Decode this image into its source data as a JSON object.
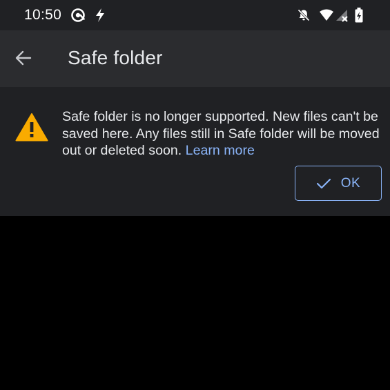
{
  "status_bar": {
    "time": "10:50",
    "icons": [
      "at-sign-icon",
      "flash-icon",
      "notifications-off-icon",
      "wifi-icon",
      "cellular-no-signal-icon",
      "battery-charging-icon"
    ]
  },
  "app_bar": {
    "title": "Safe folder",
    "back_icon": "arrow-back-icon"
  },
  "banner": {
    "icon": "warning-icon",
    "message": "Safe folder is no longer supported. New files can't be saved here. Any files still in Safe folder will be moved out or deleted soon.",
    "link_label": "Learn more",
    "ok_label": "OK",
    "ok_icon": "check-icon"
  },
  "colors": {
    "accent": "#8ab4f8",
    "warning": "#f9ab00",
    "app_bar_bg": "#2b2c2f",
    "banner_bg": "#202124",
    "text": "#e8eaed"
  }
}
